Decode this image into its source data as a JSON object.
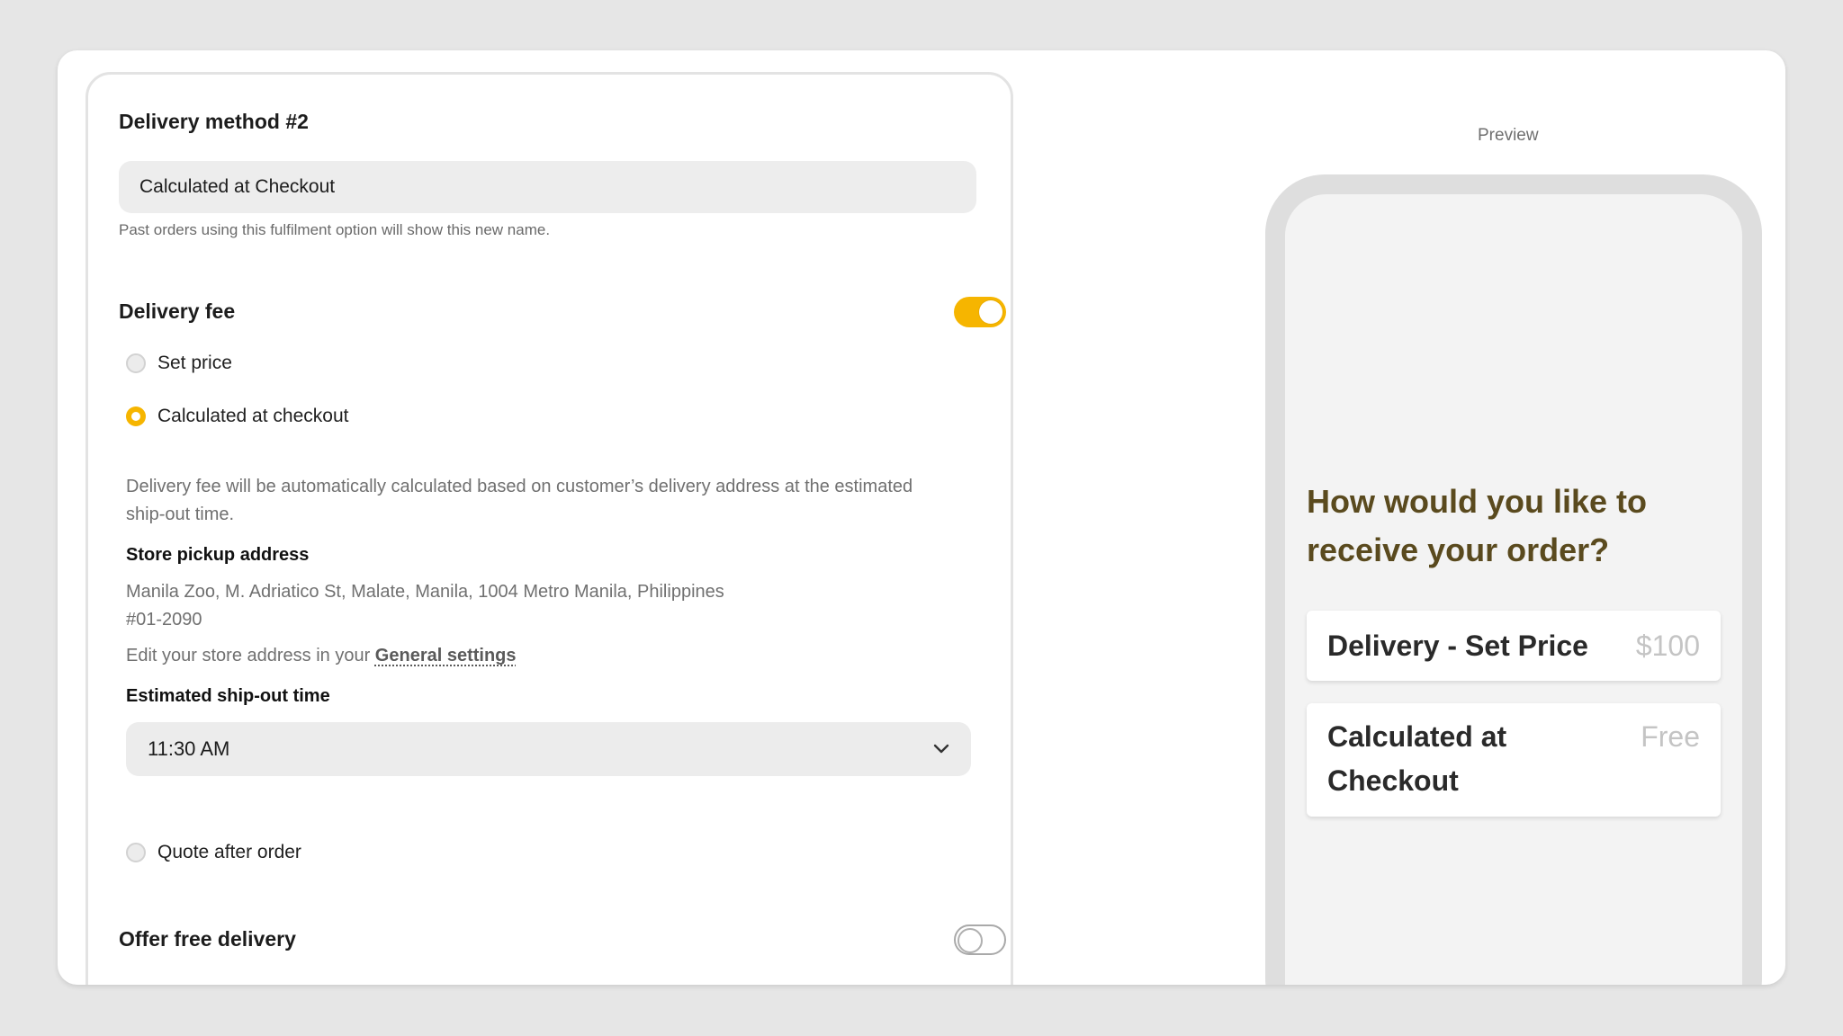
{
  "form": {
    "method_title": "Delivery method #2",
    "method_name_value": "Calculated at Checkout",
    "method_name_hint": "Past orders using this fulfilment option will show this new name.",
    "delivery_fee": {
      "title": "Delivery fee",
      "enabled": true,
      "options": [
        {
          "label": "Set price",
          "selected": false
        },
        {
          "label": "Calculated at checkout",
          "selected": true
        },
        {
          "label": "Quote after order",
          "selected": false
        }
      ],
      "auto_calc_description": "Delivery fee will be automatically calculated based on customer’s delivery address at the estimated ship-out time.",
      "pickup_label": "Store pickup address",
      "pickup_address_line1": "Manila Zoo, M. Adriatico St, Malate, Manila, 1004 Metro Manila, Philippines",
      "pickup_address_line2": "#01-2090",
      "edit_note_prefix": "Edit your store address in your ",
      "edit_note_link": "General settings",
      "ship_out_label": "Estimated ship-out time",
      "ship_out_value": "11:30 AM"
    },
    "free_delivery": {
      "title": "Offer free delivery",
      "enabled": false
    }
  },
  "preview": {
    "label": "Preview",
    "question": "How would you like to receive your order?",
    "options": [
      {
        "name": "Delivery - Set Price",
        "price": "$100"
      },
      {
        "name": "Calculated at Checkout",
        "price": "Free"
      }
    ]
  },
  "colors": {
    "accent": "#f6b500",
    "preview_question": "#5a4a1e",
    "background": "#e6e6e6"
  },
  "icons": {
    "select_arrow": "chevron-down-icon"
  }
}
